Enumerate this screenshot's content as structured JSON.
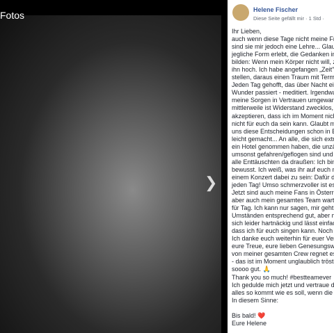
{
  "viewer": {
    "title": "Fotos",
    "next_icon": "chevron-right-icon"
  },
  "post": {
    "author": "Helene Fischer",
    "meta": "Diese Seite gefällt mir · 1 Std ·",
    "lines": [
      "Ihr Lieben,",
      "auch wenn diese Tage nicht meine Fre",
      "sind sie mir jedoch eine Lehre... Glaub",
      "jegliche Form erlebt, die Gedanken im",
      "bilden: Wenn mein Körper nicht will, zi",
      "ihn hoch. Ich habe angefangen „Zeit\" i",
      "stellen, daraus einen Traum mit Termin",
      "Jeden Tag gehofft, das über Nacht ei",
      "Wunder passiert - meditiert. Irgendwar",
      "meine Sorgen in Vertrauen umgewand",
      "mittlerweile ist Widerstand zwecklos, ic",
      "akzeptieren, dass ich im Moment nicht",
      "nicht für euch da sein kann. Glaubt mi",
      "uns diese Entscheidungen schon in Be",
      "leicht gemacht... An alle, die sich extra",
      "ein Hotel genommen haben, die unzäh",
      "umsonst gefahren/geflogen sind und le",
      "alle Enttäuschten da draußen: Ich bin",
      "bewusst. Ich weiß, was ihr auf euch ne",
      "einem Konzert dabei zu sein: Dafür da",
      "jeden Tag! Umso schmerzvoller ist es",
      "Jetzt sind auch meine Fans in Österre",
      "aber auch mein gesamtes Team warte",
      "für Tag. Ich kann nur sagen, mir geht e",
      "Umständen entsprechend gut, aber me",
      "sich leider hartnäckig und lässt einfacl",
      "dass ich für euch singen kann. Noch n",
      "Ich danke euch weiterhin für euer Vers",
      "eure Treue, eure lieben Genesungswü",
      "von meiner gesamten Crew regnet es",
      "- das ist im Moment unglaublich tröste",
      "soooo gut. 🙏",
      "Thank you so much! #bestteamever",
      "Ich gedulde mich jetzt und vertraue da",
      "alles so kommt wie es soll, wenn die Z",
      "In diesem Sinne:",
      "",
      "Bis bald! ❤️",
      "Eure Helene"
    ]
  }
}
